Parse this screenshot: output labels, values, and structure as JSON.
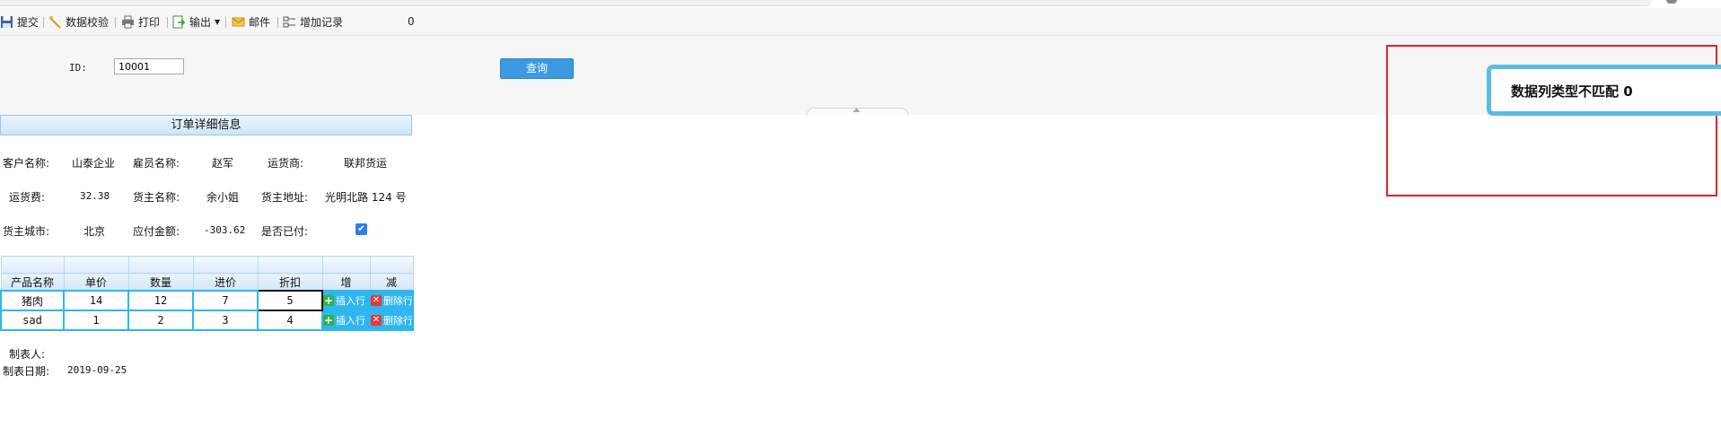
{
  "toolbar": {
    "submit": "提交",
    "validate": "数据校验",
    "print": "打印",
    "export": "输出",
    "mail": "邮件",
    "add_record": "增加记录",
    "count": "0"
  },
  "query": {
    "id_label": "ID:",
    "id_value": "10001",
    "button": "查询"
  },
  "order": {
    "title": "订单详细信息",
    "fields": {
      "customer_label": "客户名称:",
      "customer_value": "山泰企业",
      "employee_label": "雇员名称:",
      "employee_value": "赵军",
      "shipper_label": "运货商:",
      "shipper_value": "联邦货运",
      "freight_label": "运货费:",
      "freight_value": "32.38",
      "consignee_label": "货主名称:",
      "consignee_value": "余小姐",
      "address_label": "货主地址:",
      "address_value": "光明北路 124 号",
      "city_label": "货主城市:",
      "city_value": "北京",
      "payable_label": "应付金额:",
      "payable_value": "-303.62",
      "paid_label": "是否已付:",
      "paid_checked": true
    }
  },
  "grid": {
    "columns": [
      "产品名称",
      "单价",
      "数量",
      "进价",
      "折扣",
      "增",
      "减"
    ],
    "rows": [
      {
        "name": "猪肉",
        "price": "14",
        "qty": "12",
        "cost": "7",
        "discount": "5"
      },
      {
        "name": "sad",
        "price": "1",
        "qty": "2",
        "cost": "3",
        "discount": "4"
      }
    ],
    "insert_label": "插入行",
    "delete_label": "删除行"
  },
  "footer": {
    "maker_label": "制表人:",
    "date_label": "制表日期:",
    "date_value": "2019-09-25"
  },
  "toast": {
    "message": "数据列类型不匹配 0"
  },
  "colors": {
    "accent": "#3b9ae1",
    "grid_border": "#2fb6ee",
    "alert_frame": "#e52222",
    "toast_border": "#5bbbe0"
  }
}
